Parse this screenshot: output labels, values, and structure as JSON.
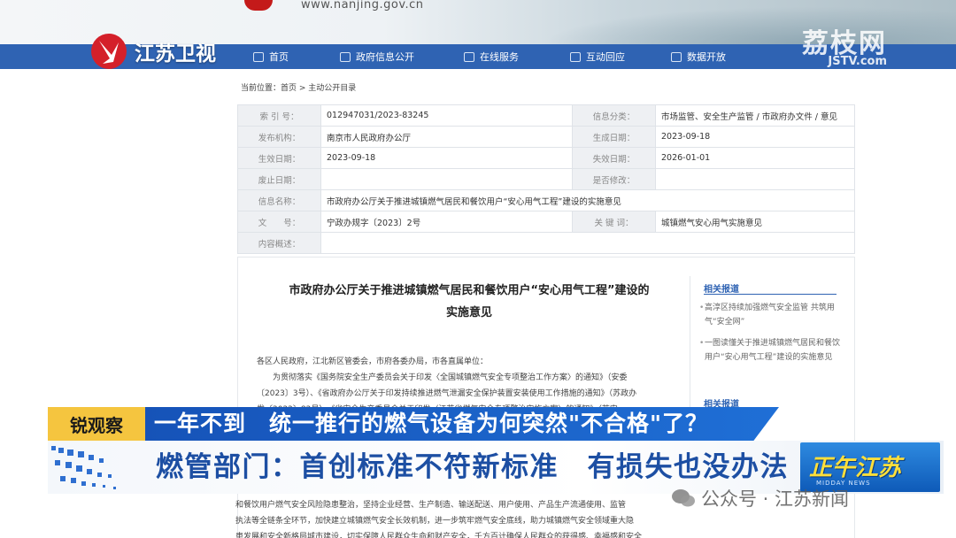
{
  "site": {
    "url": "www.nanjing.gov.cn"
  },
  "nav": {
    "items": [
      {
        "label": "首页",
        "icon": "home-icon"
      },
      {
        "label": "政府信息公开",
        "icon": "document-icon"
      },
      {
        "label": "在线服务",
        "icon": "service-icon"
      },
      {
        "label": "互动回应",
        "icon": "chat-icon"
      },
      {
        "label": "数据开放",
        "icon": "data-icon"
      }
    ]
  },
  "broadcaster": {
    "name": "江苏卫视",
    "watermark": "荔枝网",
    "watermark_sub": "JSTV.com"
  },
  "breadcrumb": {
    "text": "当前位置：首页 > 主动公开目录"
  },
  "info": {
    "rows": [
      {
        "k1": "索 引 号：",
        "v1": "012947031/2023-83245",
        "k2": "信息分类：",
        "v2": "市场监管、安全生产监管 / 市政府办文件 / 意见"
      },
      {
        "k1": "发布机构：",
        "v1": "南京市人民政府办公厅",
        "k2": "生成日期：",
        "v2": "2023-09-18"
      },
      {
        "k1": "生效日期：",
        "v1": "2023-09-18",
        "k2": "失效日期：",
        "v2": "2026-01-01"
      },
      {
        "k1": "废止日期：",
        "v1": "",
        "k2": "是否修改：",
        "v2": ""
      }
    ],
    "name_label": "信息名称：",
    "name_value": "市政府办公厅关于推进城镇燃气居民和餐饮用户“安心用气工程”建设的实施意见",
    "doc_no_label": "文　　号：",
    "doc_no_value": "宁政办规字〔2023〕2号",
    "keyword_label": "关 键 词：",
    "keyword_value": "城镇燃气安心用气实施意见",
    "summary_label": "内容概述："
  },
  "document": {
    "title_line1": "市政府办公厅关于推进城镇燃气居民和餐饮用户“安心用气工程”建设的",
    "title_line2": "实施意见",
    "salutation": "各区人民政府，江北新区管委会，市府各委办局，市各直属单位：",
    "body_line1": "为贯彻落实《国务院安全生产委员会关于印发〈全国城镇燃气安全专项整治工作方案〉的通知》（安委",
    "body_line2": "〔2023〕3号）、《省政府办公厅关于印发持续推进燃气泄漏安全保护装置安装使用工作措施的通知》（苏政办",
    "body_line3": "发〔2022〕82号）、《省安全生产委员会关于印发〈江苏省燃气安全专项整治实施方案〉的通知》（苏安",
    "bottom_line1": "和餐饮用户燃气安全风险隐患整治，坚持企业经营、生产制造、输送配送、用户使用、产品生产流通使用、监管",
    "bottom_line2": "执法等全链条全环节，加快建立城镇燃气安全长效机制，进一步筑牢燃气安全底线，助力城镇燃气安全领域重大隐",
    "bottom_line3": "患发展和安全新格局城市建设，切实保障人民群众生命和财产安全，千方百计确保人民群众的获得感、幸福感和安全"
  },
  "related": {
    "heading": "相关报道",
    "items": [
      "高淳区持续加强燃气安全监管 共筑用气“安全网”",
      "一图读懂关于推进城镇燃气居民和餐饮用户“安心用气工程”建设的实施意见"
    ],
    "heading2": "相关报道"
  },
  "news": {
    "tag": "锐观察",
    "headline": "一年不到　统一推行的燃气设备为何突然\"不合格\"了？",
    "subheadline": "燃管部门：首创标准不符新标准　有损失也没办法",
    "program": "正午江苏",
    "program_sub": "MIDDAY NEWS"
  },
  "wechat_watermark": "公众号 · 江苏新闻",
  "colors": {
    "nav": "#2f63b3",
    "tag": "#f5c53f",
    "headline": "#1653b8",
    "sub_text": "#1d4fa3",
    "logo_red": "#d4202a"
  }
}
